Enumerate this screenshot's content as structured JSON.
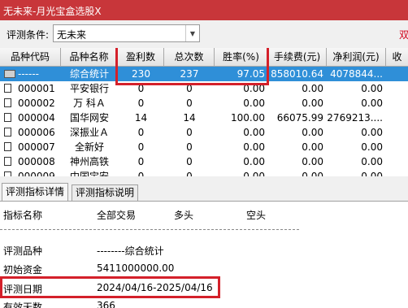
{
  "window": {
    "title": "无未来-月光宝盒选股X"
  },
  "filter": {
    "label": "评测条件:",
    "value": "无未来",
    "right_text": "双"
  },
  "table": {
    "columns": [
      "品种代码",
      "品种名称",
      "盈利数",
      "总次数",
      "胜率(%)",
      "手续费(元)",
      "净利润(元)",
      "收"
    ],
    "rows": [
      {
        "code": "------",
        "name": "综合统计",
        "wins": "230",
        "total": "237",
        "rate": "97.05",
        "fee": "858010.64",
        "profit": "4078844...",
        "selected": true
      },
      {
        "code": "000001",
        "name": "平安银行",
        "wins": "0",
        "total": "0",
        "rate": "0.00",
        "fee": "0.00",
        "profit": "0.00"
      },
      {
        "code": "000002",
        "name": "万 科Ａ",
        "wins": "0",
        "total": "0",
        "rate": "0.00",
        "fee": "0.00",
        "profit": "0.00"
      },
      {
        "code": "000004",
        "name": "国华网安",
        "wins": "14",
        "total": "14",
        "rate": "100.00",
        "fee": "66075.99",
        "profit": "2769213...."
      },
      {
        "code": "000006",
        "name": "深振业Ａ",
        "wins": "0",
        "total": "0",
        "rate": "0.00",
        "fee": "0.00",
        "profit": "0.00"
      },
      {
        "code": "000007",
        "name": "全新好",
        "wins": "0",
        "total": "0",
        "rate": "0.00",
        "fee": "0.00",
        "profit": "0.00"
      },
      {
        "code": "000008",
        "name": "神州高铁",
        "wins": "0",
        "total": "0",
        "rate": "0.00",
        "fee": "0.00",
        "profit": "0.00"
      },
      {
        "code": "000009",
        "name": "中国宝安",
        "wins": "0",
        "total": "0",
        "rate": "0.00",
        "fee": "0.00",
        "profit": "0.00"
      }
    ]
  },
  "tabs": [
    {
      "label": "评测指标详情",
      "active": true
    },
    {
      "label": "评测指标说明",
      "active": false
    }
  ],
  "detail": {
    "header": [
      "指标名称",
      "全部交易",
      "多头",
      "空头"
    ],
    "items": [
      {
        "name": "评测品种",
        "value": "--------综合统计"
      },
      {
        "name": "初始资金",
        "value": "5411000000.00"
      },
      {
        "name": "评测日期",
        "value": "2024/04/16-2025/04/16"
      },
      {
        "name": "有效天数",
        "value": "366"
      }
    ]
  },
  "colors": {
    "title_bar": "#c8363a",
    "selection": "#2f8fd8",
    "highlight_box": "#d4202a"
  },
  "icons": {
    "summary_row": "folder-icon",
    "stock_row": "file-icon",
    "combo_arrow": "triangle-down-icon"
  }
}
